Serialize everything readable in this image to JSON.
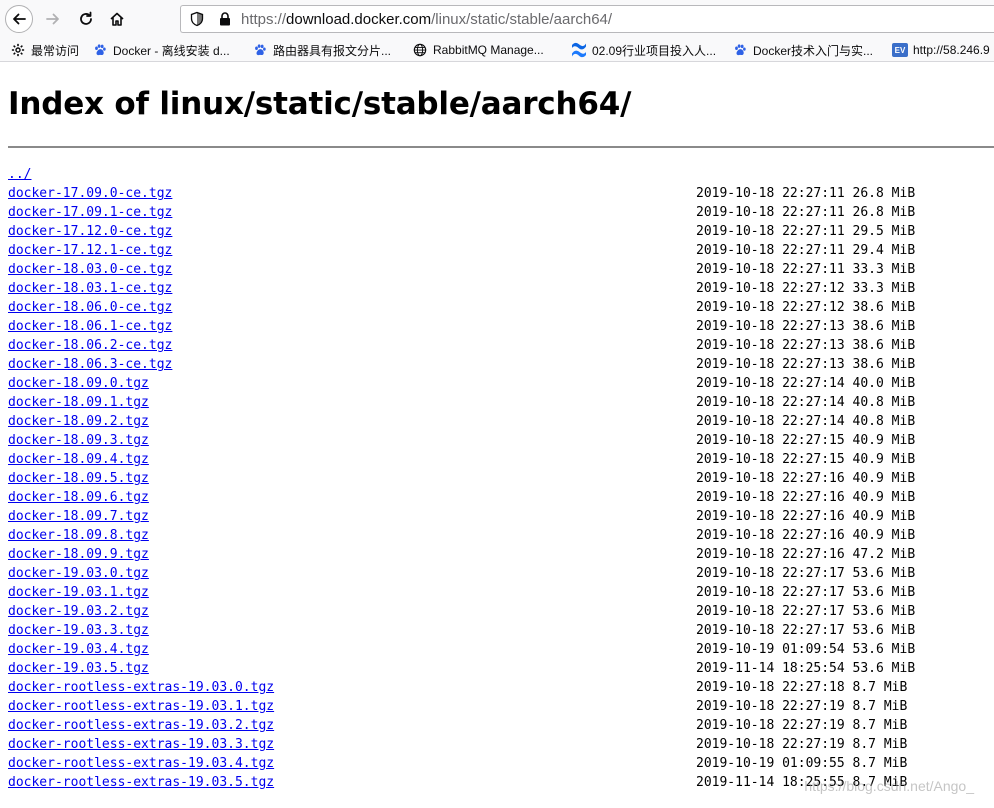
{
  "browser": {
    "url_scheme": "https://",
    "url_host": "download.docker.com",
    "url_path": "/linux/static/stable/aarch64/",
    "bookmarks": [
      {
        "label": "最常访问",
        "icon": "gear-icon"
      },
      {
        "label": "Docker - 离线安装 d...",
        "icon": "baidu-paw-icon"
      },
      {
        "label": "路由器具有报文分片...",
        "icon": "baidu-paw-icon"
      },
      {
        "label": "RabbitMQ Manage...",
        "icon": "globe-icon"
      },
      {
        "label": "02.09行业项目投入人...",
        "icon": "confluence-icon"
      },
      {
        "label": "Docker技术入门与实...",
        "icon": "baidu-paw-icon"
      },
      {
        "label": "http://58.246.9",
        "icon": "ev-icon",
        "badge": "EV"
      }
    ]
  },
  "page": {
    "title": "Index of linux/static/stable/aarch64/",
    "parent_link": "../",
    "files": [
      {
        "name": "docker-17.09.0-ce.tgz",
        "meta": "2019-10-18 22:27:11 26.8 MiB"
      },
      {
        "name": "docker-17.09.1-ce.tgz",
        "meta": "2019-10-18 22:27:11 26.8 MiB"
      },
      {
        "name": "docker-17.12.0-ce.tgz",
        "meta": "2019-10-18 22:27:11 29.5 MiB"
      },
      {
        "name": "docker-17.12.1-ce.tgz",
        "meta": "2019-10-18 22:27:11 29.4 MiB"
      },
      {
        "name": "docker-18.03.0-ce.tgz",
        "meta": "2019-10-18 22:27:11 33.3 MiB"
      },
      {
        "name": "docker-18.03.1-ce.tgz",
        "meta": "2019-10-18 22:27:12 33.3 MiB"
      },
      {
        "name": "docker-18.06.0-ce.tgz",
        "meta": "2019-10-18 22:27:12 38.6 MiB"
      },
      {
        "name": "docker-18.06.1-ce.tgz",
        "meta": "2019-10-18 22:27:13 38.6 MiB"
      },
      {
        "name": "docker-18.06.2-ce.tgz",
        "meta": "2019-10-18 22:27:13 38.6 MiB"
      },
      {
        "name": "docker-18.06.3-ce.tgz",
        "meta": "2019-10-18 22:27:13 38.6 MiB"
      },
      {
        "name": "docker-18.09.0.tgz",
        "meta": "2019-10-18 22:27:14 40.0 MiB"
      },
      {
        "name": "docker-18.09.1.tgz",
        "meta": "2019-10-18 22:27:14 40.8 MiB"
      },
      {
        "name": "docker-18.09.2.tgz",
        "meta": "2019-10-18 22:27:14 40.8 MiB"
      },
      {
        "name": "docker-18.09.3.tgz",
        "meta": "2019-10-18 22:27:15 40.9 MiB"
      },
      {
        "name": "docker-18.09.4.tgz",
        "meta": "2019-10-18 22:27:15 40.9 MiB"
      },
      {
        "name": "docker-18.09.5.tgz",
        "meta": "2019-10-18 22:27:16 40.9 MiB"
      },
      {
        "name": "docker-18.09.6.tgz",
        "meta": "2019-10-18 22:27:16 40.9 MiB"
      },
      {
        "name": "docker-18.09.7.tgz",
        "meta": "2019-10-18 22:27:16 40.9 MiB"
      },
      {
        "name": "docker-18.09.8.tgz",
        "meta": "2019-10-18 22:27:16 40.9 MiB"
      },
      {
        "name": "docker-18.09.9.tgz",
        "meta": "2019-10-18 22:27:16 47.2 MiB"
      },
      {
        "name": "docker-19.03.0.tgz",
        "meta": "2019-10-18 22:27:17 53.6 MiB"
      },
      {
        "name": "docker-19.03.1.tgz",
        "meta": "2019-10-18 22:27:17 53.6 MiB"
      },
      {
        "name": "docker-19.03.2.tgz",
        "meta": "2019-10-18 22:27:17 53.6 MiB"
      },
      {
        "name": "docker-19.03.3.tgz",
        "meta": "2019-10-18 22:27:17 53.6 MiB"
      },
      {
        "name": "docker-19.03.4.tgz",
        "meta": "2019-10-19 01:09:54 53.6 MiB"
      },
      {
        "name": "docker-19.03.5.tgz",
        "meta": "2019-11-14 18:25:54 53.6 MiB"
      },
      {
        "name": "docker-rootless-extras-19.03.0.tgz",
        "meta": "2019-10-18 22:27:18 8.7 MiB"
      },
      {
        "name": "docker-rootless-extras-19.03.1.tgz",
        "meta": "2019-10-18 22:27:19 8.7 MiB"
      },
      {
        "name": "docker-rootless-extras-19.03.2.tgz",
        "meta": "2019-10-18 22:27:19 8.7 MiB"
      },
      {
        "name": "docker-rootless-extras-19.03.3.tgz",
        "meta": "2019-10-18 22:27:19 8.7 MiB"
      },
      {
        "name": "docker-rootless-extras-19.03.4.tgz",
        "meta": "2019-10-19 01:09:55 8.7 MiB"
      },
      {
        "name": "docker-rootless-extras-19.03.5.tgz",
        "meta": "2019-11-14 18:25:55 8.7 MiB"
      }
    ],
    "watermark": "https://blog.csdn.net/Ango_"
  },
  "colors": {
    "link": "#0000ee",
    "chrome_bg": "#f9f9fa"
  }
}
